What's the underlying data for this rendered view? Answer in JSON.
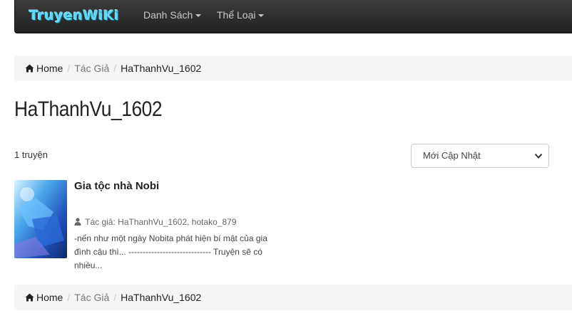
{
  "nav": {
    "logo": "TruyenWiKi",
    "items": [
      "Danh Sách",
      "Thể Loại"
    ]
  },
  "breadcrumb": {
    "home": "Home",
    "section": "Tác Giả",
    "current": "HaThanhVu_1602"
  },
  "page": {
    "title": "HaThanhVu_1602",
    "count": "1 truyện"
  },
  "sort": {
    "selected": "Mới Cập Nhật"
  },
  "story": {
    "title": "Gia tộc nhà Nobi",
    "author_label": "Tác giả:",
    "authors": "HaThanhVu_1602, hotako_879",
    "description": "-nến như một ngày Nobita phát hiện bí mật của gia đình cậu thì... ----------------------------- Truyện sẽ có nhiều..."
  },
  "colors": {
    "navbar": "#222222",
    "logo": "#5fd8f5",
    "breadcrumb_bg": "#f5f5f5"
  }
}
